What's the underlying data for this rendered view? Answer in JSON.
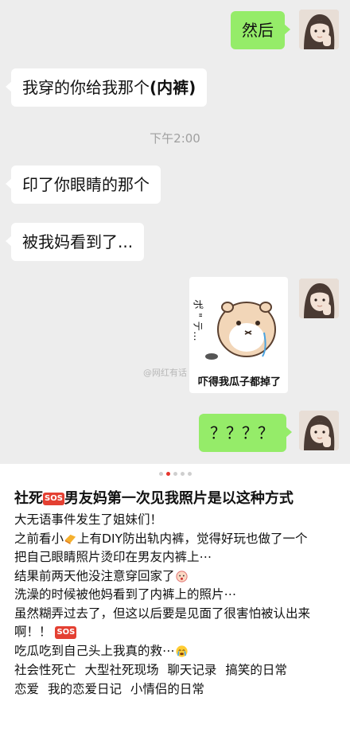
{
  "chat": {
    "messages": [
      {
        "side": "out",
        "text": "然后"
      },
      {
        "side": "in",
        "text": "我穿的你给我那个",
        "strong": "(内裤)"
      },
      {
        "side": "in",
        "text": "印了你眼睛的那个"
      },
      {
        "side": "in",
        "text": "被我妈看到了..."
      },
      {
        "side": "out",
        "text": "？？？？"
      }
    ],
    "time_label": "下午2:00",
    "sticker": {
      "caption": "吓得我瓜子都掉了",
      "side_text": "ポ \" テ..."
    },
    "watermark": "@网红有话"
  },
  "pager": {
    "count": 5,
    "active_index": 1
  },
  "post": {
    "title_a": "社死",
    "title_b": "男友妈第一次见我照片是以这种方式",
    "sos_label": "SOS",
    "lines": {
      "l1": "大无语事件发生了姐妹们！",
      "l2a": "之前看小",
      "l2b": "上有DIY防出轨内裤，觉得好玩也做了一个",
      "l3": "把自己眼睛照片烫印在男友内裤上⋯",
      "l4": "结果前两天他没注意穿回家了",
      "l5": "洗澡的时候被他妈看到了内裤上的照片⋯",
      "l6": "虽然糊弄过去了，但这以后要是见面了很害怕被认出来啊！！",
      "l7": "吃瓜吃到自己头上我真的救⋯"
    },
    "tags": [
      "社会性死亡",
      "大型社死现场",
      "聊天记录",
      "搞笑的日常",
      "恋爱",
      "我的恋爱日记",
      "小情侣的日常"
    ]
  },
  "colors": {
    "chat_bg": "#ededed",
    "out_bubble": "#95ec69",
    "in_bubble": "#ffffff",
    "accent": "#e6342c"
  }
}
